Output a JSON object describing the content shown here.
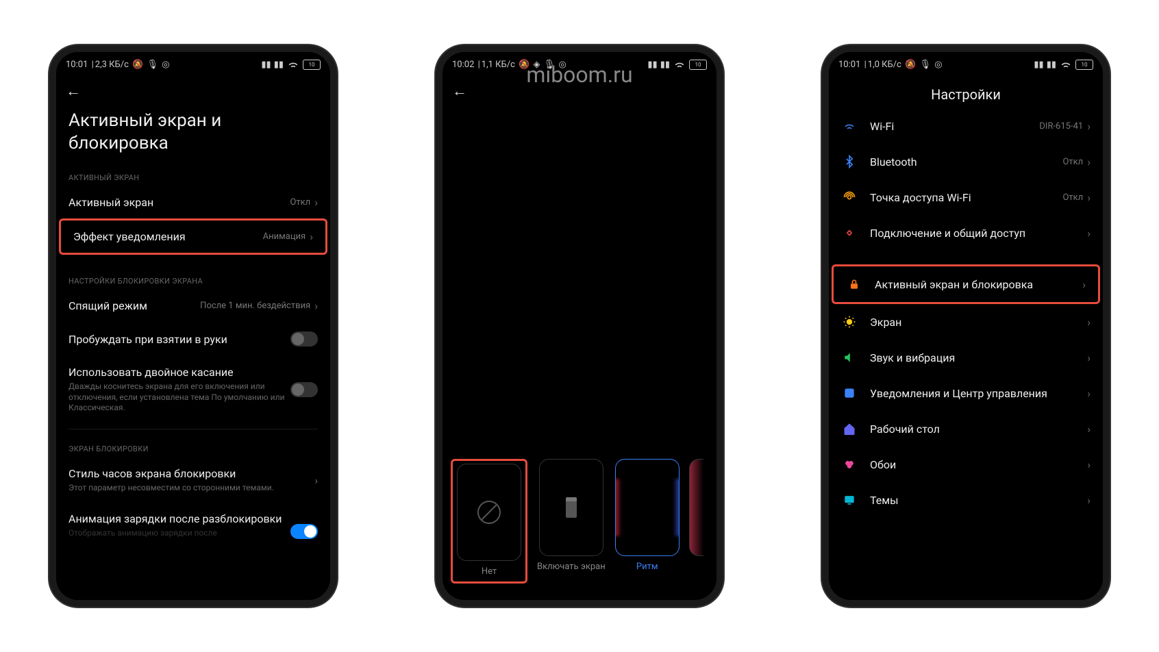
{
  "watermark": "miboom.ru",
  "phone1": {
    "status": {
      "time": "10:01",
      "speed": "2,3 КБ/с",
      "battery": "10"
    },
    "title": "Активный экран и блокировка",
    "section1": "АКТИВНЫЙ ЭКРАН",
    "row_active": {
      "label": "Активный экран",
      "value": "Откл"
    },
    "row_effect": {
      "label": "Эффект уведомления",
      "value": "Анимация"
    },
    "section2": "НАСТРОЙКИ БЛОКИРОВКИ ЭКРАНА",
    "row_sleep": {
      "label": "Спящий режим",
      "value": "После 1 мин. бездействия"
    },
    "row_raise": {
      "label": "Пробуждать при взятии в руки"
    },
    "row_double": {
      "label": "Использовать двойное касание",
      "sub": "Дважды коснитесь экрана для его включения или отключения, если установлена тема По умолчанию или Классическая."
    },
    "section3": "ЭКРАН БЛОКИРОВКИ",
    "row_clock": {
      "label": "Стиль часов экрана блокировки",
      "sub": "Этот параметр несовместим со сторонними темами."
    },
    "row_charge": {
      "label": "Анимация зарядки после разблокировки",
      "sub": "Отображать анимацию зарядки после"
    }
  },
  "phone2": {
    "status": {
      "time": "10:02",
      "speed": "1,1 КБ/с",
      "battery": "10"
    },
    "effects": {
      "none": "Нет",
      "screen": "Включать экран",
      "rhythm": "Ритм"
    }
  },
  "phone3": {
    "status": {
      "time": "10:01",
      "speed": "1,0 КБ/с",
      "battery": "10"
    },
    "title": "Настройки",
    "rows": {
      "wifi": {
        "label": "Wi-Fi",
        "value": "DIR-615-41"
      },
      "bt": {
        "label": "Bluetooth",
        "value": "Откл"
      },
      "hotspot": {
        "label": "Точка доступа Wi-Fi",
        "value": "Откл"
      },
      "share": {
        "label": "Подключение и общий доступ"
      },
      "active": {
        "label": "Активный экран и блокировка"
      },
      "display": {
        "label": "Экран"
      },
      "sound": {
        "label": "Звук и вибрация"
      },
      "notif": {
        "label": "Уведомления и Центр управления"
      },
      "home": {
        "label": "Рабочий стол"
      },
      "wall": {
        "label": "Обои"
      },
      "theme": {
        "label": "Темы"
      }
    }
  }
}
